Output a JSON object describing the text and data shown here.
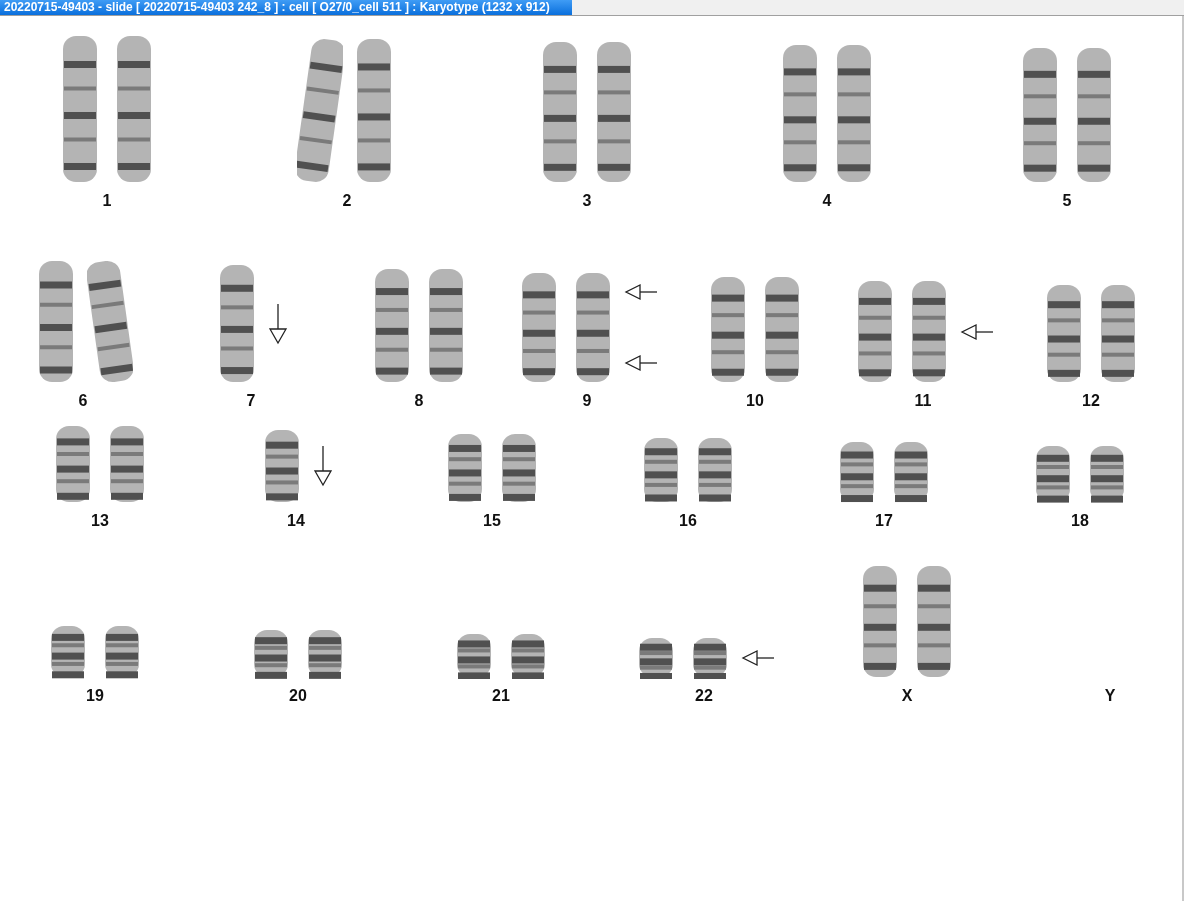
{
  "window": {
    "title": "20220715-49403 - slide [ 20220715-49403 242_8 ] : cell [ O27/0_cell 511 ] : Karyotype  (1232 x 912)"
  },
  "rows": [
    {
      "chromosomes": [
        {
          "label": "1",
          "homologs": [
            {
              "kind": "straight"
            },
            {
              "kind": "straight"
            }
          ]
        },
        {
          "label": "2",
          "homologs": [
            {
              "kind": "bent"
            },
            {
              "kind": "straight"
            }
          ]
        },
        {
          "label": "3",
          "homologs": [
            {
              "kind": "straight"
            },
            {
              "kind": "straight"
            }
          ]
        },
        {
          "label": "4",
          "homologs": [
            {
              "kind": "straight"
            },
            {
              "kind": "straight"
            }
          ]
        },
        {
          "label": "5",
          "homologs": [
            {
              "kind": "straight"
            },
            {
              "kind": "straight"
            }
          ]
        }
      ]
    },
    {
      "chromosomes": [
        {
          "label": "6",
          "homologs": [
            {
              "kind": "straight"
            },
            {
              "kind": "bent"
            }
          ]
        },
        {
          "label": "7",
          "homologs": [
            {
              "kind": "straight"
            }
          ],
          "arrows": [
            {
              "kind": "down"
            }
          ]
        },
        {
          "label": "8",
          "homologs": [
            {
              "kind": "straight"
            },
            {
              "kind": "straight"
            }
          ]
        },
        {
          "label": "9",
          "homologs": [
            {
              "kind": "straight"
            },
            {
              "kind": "straight"
            }
          ],
          "arrows": [
            {
              "kind": "left"
            },
            {
              "kind": "left"
            }
          ]
        },
        {
          "label": "10",
          "homologs": [
            {
              "kind": "straight"
            },
            {
              "kind": "straight"
            }
          ]
        },
        {
          "label": "11",
          "homologs": [
            {
              "kind": "straight"
            },
            {
              "kind": "straight"
            }
          ],
          "arrows": [
            {
              "kind": "left"
            }
          ]
        },
        {
          "label": "12",
          "homologs": [
            {
              "kind": "straight"
            },
            {
              "kind": "straight"
            }
          ]
        }
      ]
    },
    {
      "chromosomes": [
        {
          "label": "13",
          "homologs": [
            {
              "kind": "straight"
            },
            {
              "kind": "straight"
            }
          ]
        },
        {
          "label": "14",
          "homologs": [
            {
              "kind": "straight"
            }
          ],
          "arrows": [
            {
              "kind": "down"
            }
          ]
        },
        {
          "label": "15",
          "homologs": [
            {
              "kind": "straight"
            },
            {
              "kind": "straight"
            }
          ]
        },
        {
          "label": "16",
          "homologs": [
            {
              "kind": "straight"
            },
            {
              "kind": "straight"
            }
          ]
        },
        {
          "label": "17",
          "homologs": [
            {
              "kind": "straight"
            },
            {
              "kind": "straight"
            }
          ]
        },
        {
          "label": "18",
          "homologs": [
            {
              "kind": "straight"
            },
            {
              "kind": "straight"
            }
          ]
        }
      ]
    },
    {
      "chromosomes": [
        {
          "label": "19",
          "homologs": [
            {
              "kind": "straight"
            },
            {
              "kind": "straight"
            }
          ]
        },
        {
          "label": "20",
          "homologs": [
            {
              "kind": "straight"
            },
            {
              "kind": "straight"
            }
          ]
        },
        {
          "label": "21",
          "homologs": [
            {
              "kind": "straight"
            },
            {
              "kind": "straight"
            }
          ]
        },
        {
          "label": "22",
          "homologs": [
            {
              "kind": "straight"
            },
            {
              "kind": "straight"
            }
          ],
          "arrows": [
            {
              "kind": "left"
            }
          ]
        },
        {
          "label": "X",
          "homologs": [
            {
              "kind": "straight"
            },
            {
              "kind": "straight"
            }
          ]
        },
        {
          "label": "Y"
        }
      ]
    }
  ]
}
